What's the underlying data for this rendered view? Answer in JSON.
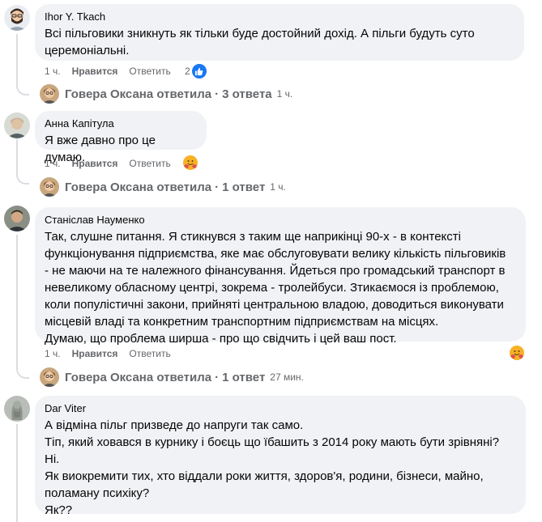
{
  "comments": [
    {
      "author": "Ihor Y. Tkach",
      "lines": [
        "Всі пільговики зникнуть як тільки буде достойний дохід. А пільги будуть суто",
        "церемоніальні."
      ],
      "time": "1 ч.",
      "like_label": "Нравится",
      "reply_label": "Ответить",
      "reaction_count": "2",
      "replies": {
        "name": "Говера Оксана ответила",
        "sep": "·",
        "count": "3 ответа",
        "time": "1 ч."
      }
    },
    {
      "author": "Анна Капітула",
      "lines": [
        "Я вже давно про це думаю."
      ],
      "time": "1 ч.",
      "like_label": "Нравится",
      "reply_label": "Ответить",
      "replies": {
        "name": "Говера Оксана ответила",
        "sep": "·",
        "count": "1 ответ",
        "time": "1 ч."
      }
    },
    {
      "author": "Станіслав Науменко",
      "lines": [
        "Так, слушне питання. Я стикнувся з таким ще наприкінці 90-х - в контексті",
        "функціонування підприємства, яке має обслуговувати велику кількість пільговиків",
        "- не маючи на те належного фінансування. Йдеться про громадський транспорт в",
        "невеликому обласному центрі, зокрема - тролейбуси. Зтикаємося із проблемою,",
        "коли популістичні закони, прийняті центральною владою, доводиться виконувати",
        "місцевій владі та конкретним транспортним підприємствам на місцях.",
        "Думаю, що проблема ширша - про що свідчить і цей ваш пост."
      ],
      "time": "1 ч.",
      "like_label": "Нравится",
      "reply_label": "Ответить",
      "replies": {
        "name": "Говера Оксана ответила",
        "sep": "·",
        "count": "1 ответ",
        "time": "27 мин."
      }
    },
    {
      "author": "Dar Viter",
      "lines": [
        "А відміна пільг призведе до напруги так само.",
        "Тіп, який ховався в курнику і боєць що їбашить з 2014 року мають бути зрівняні?",
        "Ні.",
        "Як виокремити тих, хто віддали роки життя, здоров'я, родини, бізнеси, майно,",
        "поламану психіку?",
        "Як??"
      ]
    }
  ],
  "colors": {
    "bubble": "#f0f2f5",
    "meta": "#65676b",
    "like_blue": "#1877f2",
    "line": "#dadde1"
  }
}
